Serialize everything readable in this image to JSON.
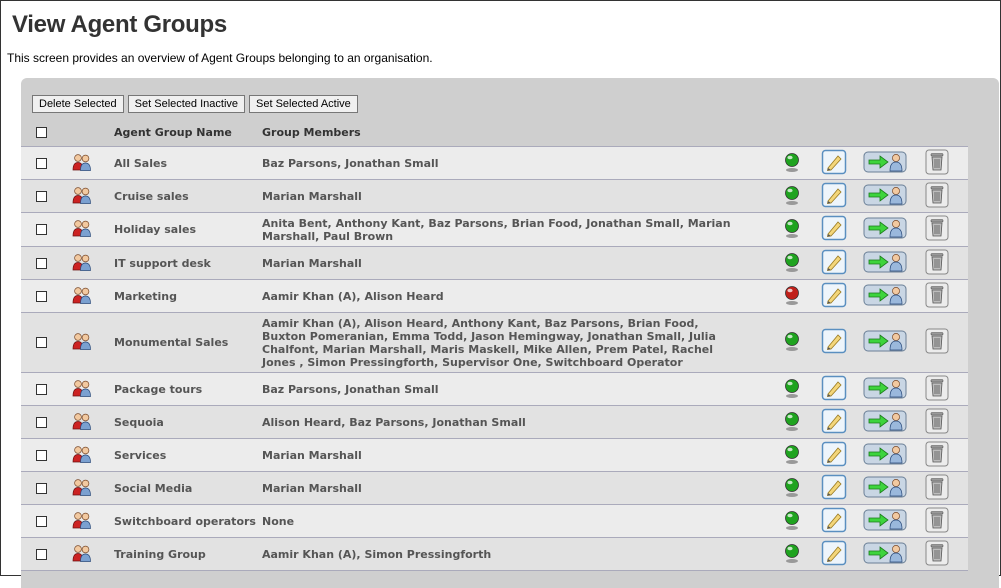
{
  "page": {
    "title": "View Agent Groups",
    "description": "This screen provides an overview of Agent Groups belonging to an organisation."
  },
  "toolbar": {
    "delete_label": "Delete Selected",
    "inactive_label": "Set Selected Inactive",
    "active_label": "Set Selected Active"
  },
  "table": {
    "headers": {
      "name": "Agent Group Name",
      "members": "Group Members"
    },
    "rows": [
      {
        "name": "All Sales",
        "members": "Baz Parsons, Jonathan Small",
        "status": "active"
      },
      {
        "name": "Cruise sales",
        "members": "Marian Marshall",
        "status": "active"
      },
      {
        "name": "Holiday sales",
        "members": "Anita Bent, Anthony Kant, Baz Parsons, Brian Food, Jonathan Small, Marian Marshall, Paul Brown",
        "status": "active"
      },
      {
        "name": "IT support desk",
        "members": "Marian Marshall",
        "status": "active"
      },
      {
        "name": "Marketing",
        "members": "Aamir Khan (A), Alison Heard",
        "status": "inactive"
      },
      {
        "name": "Monumental Sales",
        "members": "Aamir Khan (A), Alison Heard, Anthony Kant, Baz Parsons, Brian Food, Buxton Pomeranian, Emma Todd, Jason Hemingway, Jonathan Small, Julia Chalfont, Marian Marshall, Maris Maskell, Mike Allen, Prem Patel, Rachel Jones , Simon Pressingforth, Supervisor One, Switchboard Operator",
        "status": "active"
      },
      {
        "name": "Package tours",
        "members": "Baz Parsons, Jonathan Small",
        "status": "active"
      },
      {
        "name": "Sequoia",
        "members": "Alison Heard, Baz Parsons, Jonathan Small",
        "status": "active"
      },
      {
        "name": "Services",
        "members": "Marian Marshall",
        "status": "active"
      },
      {
        "name": "Social Media",
        "members": "Marian Marshall",
        "status": "active"
      },
      {
        "name": "Switchboard operators",
        "members": "None",
        "status": "active"
      },
      {
        "name": "Training Group",
        "members": "Aamir Khan (A), Simon Pressingforth",
        "status": "active"
      }
    ]
  },
  "colors": {
    "status_active": "#1fa31f",
    "status_inactive": "#c0201a",
    "panel_bg": "#cfcfcf"
  },
  "icons": {
    "group": "agent-group-icon",
    "status": "status-dot-icon",
    "edit": "edit-icon",
    "assign": "assign-agents-icon",
    "delete": "trash-icon"
  }
}
